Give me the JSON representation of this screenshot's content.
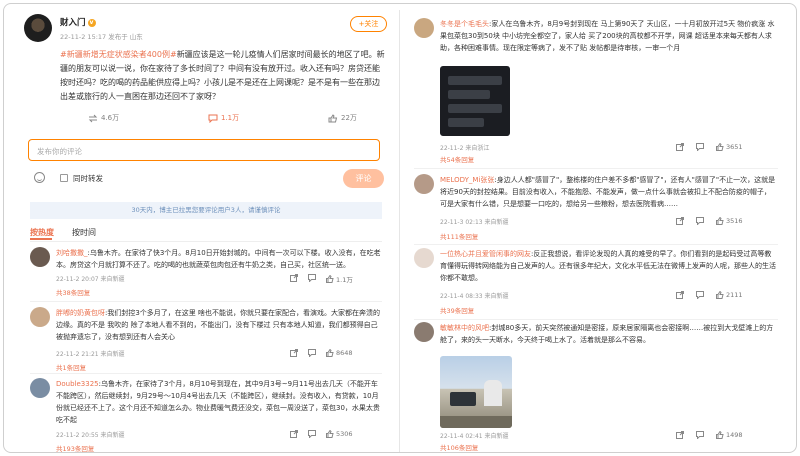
{
  "post": {
    "author": "财入门",
    "verified_badge": "v",
    "meta": "22-11-2 15:17 发布于 山东",
    "follow_label": "+关注",
    "hashtag": "#新疆新增无症状感染者400例#",
    "text": "新疆应该是这一轮儿疫情人们居家时间最长的地区了吧。新疆的朋友可以说一说，你在家待了多长时间了？中间有没有放开过。收入还有吗？房贷还能按时还吗？吃的喝的药品能供应得上吗？小孩儿是不是还在上网课呢？是不是有一些在那边出差或旅行的人一直困在那边还回不了家呀？",
    "reposts": "4.6万",
    "comments": "1.1万",
    "likes": "22万"
  },
  "comment_box": {
    "placeholder": "发布你的评论",
    "repost_option": "同时转发",
    "submit_label": "评论"
  },
  "notice": "30天内，博主已拉黑您要评论用户3人，请谨慎评论",
  "tabs": [
    {
      "label": "按热度",
      "active": true
    },
    {
      "label": "按时间",
      "active": false
    }
  ],
  "left_comments": [
    {
      "name": "刘哈撒撒_",
      "text": ":乌鲁木齐。在家待了快3个月。8月10日开始封城的。中间有一次可以下楼。收入没有，在吃老本。房贷这个月就打算不还了。吃的喝的也就蔬菜包肉包还有牛奶之类，自己买，社区统一送。",
      "meta": "22-11-2 20:07 来自新疆",
      "likes": "1.1万",
      "avatar_color": "#6a5a50"
    },
    {
      "name": "胖嘟的奶黄包呀",
      "text": ":我们封控3个多月了，在这里 啥也不能说，你就只要在家配合，看演戏。大家都在奔溃的边缘。真的不是 我吹的 除了本地人看不到的，不能出门，没有下楼过 只有本地人知道，我们都预得自己被抛弃遗忘了，没有想到还有人会关心",
      "meta": "22-11-2 21:21 来自新疆",
      "likes": "8648",
      "avatar_color": "#caa98a"
    },
    {
      "name": "Double3325",
      "text": ":乌鲁木齐，在家待了3个月，8月10号到现在，其中9月3号~9月11号出去几天（不能开车不能跨区），然后继续封，9月29号～10月4号出去几天（不能跨区），继续封。没有收入，有贷款，10月份就已经还不上了。这个月还不知道怎么办。物业费暖气费还没交，菜包一周没送了，菜包30，水果太贵吃不起",
      "meta": "22-11-2 20:55 来自新疆",
      "likes": "5306",
      "avatar_color": "#7a8da3",
      "reply_count": "共193条回复"
    }
  ],
  "left_reply_counts": [
    "共38条回复",
    "共1条回复",
    "共193条回复"
  ],
  "right_comments": [
    {
      "name": "冬冬是个毛毛头",
      "text": ":家人在乌鲁木齐，8月9号封到现在 马上第90天了 天山区，一十月初放开过5天 物价疯涨 水果包菜包30到50块 中小坊完全都空了，家人给 买了200块的高校都不开学，网课 超话里本来每天都有人求助，各种困难事情。现在限定等病了，发不了贴 发帖都是待审核，一审一个月",
      "meta": "22-11-2 来自浙江",
      "likes": "3651",
      "reply_count": "共54条回复",
      "avatar_color": "#c9a780"
    },
    {
      "name": "MELODY_Mi张张",
      "text": ":身边人人都\"感冒了\"，整栋楼的住户差不多都\"感冒了\"，还有人\"感冒了\"不止一次，这就是将近90天的封控结果。目前没有收入，不能抱怨、不能发声，做一点什么事就会被扣上不配合防疫的帽子，可是大家有什么错，只是想要一口吃的，想给另一些粮粉，想去医院看病……",
      "meta": "22-11-3 02:13 来自新疆",
      "likes": "3516",
      "reply_count": "共111条回复",
      "avatar_color": "#b59a88"
    },
    {
      "name": "一位热心并且爱管闲事的网友",
      "text": ":反正我想说，看评论发现的人真的难受的早了。你们看到的是起码受过高等教育懂得玩得转网络能为自己发声的人。还有很多年纪大，文化水平低无法在微博上发声的人呢，那些人的生活你都不敢想。",
      "meta": "22-11-4 08:33 来自新疆",
      "likes": "2111",
      "reply_count": "共39条回复",
      "avatar_color": "#e6d9d0"
    },
    {
      "name": "敏敏林中的风吧",
      "text": ":封城80多天，前天突然被通知是密接，原来居家隔离也会密接啊……被拉到大戈壁滩上的方舱了，来的头一天断水，今天终于喝上水了。活着就是那么不容易。",
      "meta": "22-11-4 02:41 来自新疆",
      "likes": "1498",
      "reply_count": "共106条回复",
      "avatar_color": "#8a7b70"
    }
  ]
}
